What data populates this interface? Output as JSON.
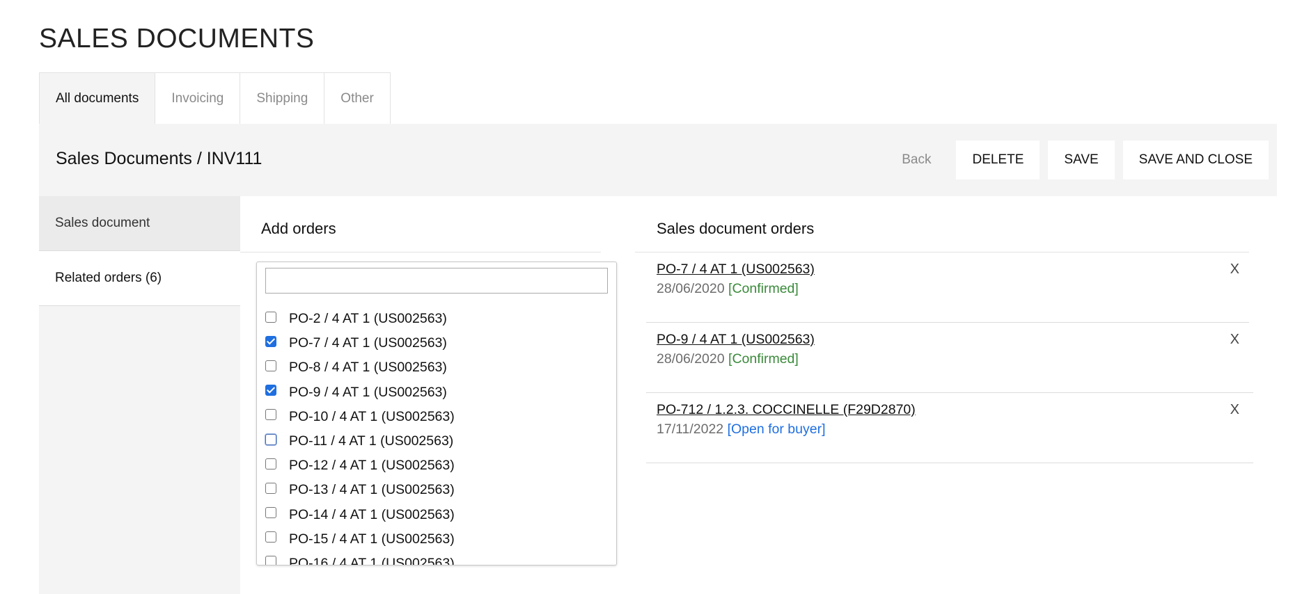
{
  "page": {
    "title": "SALES DOCUMENTS"
  },
  "tabs": [
    {
      "label": "All documents",
      "active": true
    },
    {
      "label": "Invoicing",
      "active": false
    },
    {
      "label": "Shipping",
      "active": false
    },
    {
      "label": "Other",
      "active": false
    }
  ],
  "header": {
    "breadcrumb": "Sales Documents / INV111",
    "back_label": "Back",
    "delete_label": "DELETE",
    "save_label": "SAVE",
    "save_close_label": "SAVE AND CLOSE"
  },
  "sidebar": {
    "items": [
      {
        "label": "Sales document"
      },
      {
        "label": "Related orders (6)"
      }
    ]
  },
  "add_orders": {
    "title": "Add orders",
    "search_value": "",
    "search_placeholder": "",
    "options": [
      {
        "label": "PO-2 / 4 AT 1 (US002563)",
        "checked": false
      },
      {
        "label": "PO-7 / 4 AT 1 (US002563)",
        "checked": true
      },
      {
        "label": "PO-8 / 4 AT 1 (US002563)",
        "checked": false
      },
      {
        "label": "PO-9 / 4 AT 1 (US002563)",
        "checked": true
      },
      {
        "label": "PO-10 / 4 AT 1 (US002563)",
        "checked": false
      },
      {
        "label": "PO-11 / 4 AT 1 (US002563)",
        "checked": false
      },
      {
        "label": "PO-12 / 4 AT 1 (US002563)",
        "checked": false
      },
      {
        "label": "PO-13 / 4 AT 1 (US002563)",
        "checked": false
      },
      {
        "label": "PO-14 / 4 AT 1 (US002563)",
        "checked": false
      },
      {
        "label": "PO-15 / 4 AT 1 (US002563)",
        "checked": false
      },
      {
        "label": "PO-16 / 4 AT 1 (US002563)",
        "checked": false
      }
    ]
  },
  "sales_document_orders": {
    "title": "Sales document orders",
    "remove_label": "X",
    "orders": [
      {
        "name": "PO-7 / 4 AT 1 (US002563)",
        "date": "28/06/2020",
        "status": "[Confirmed]"
      },
      {
        "name": "PO-9 / 4 AT 1 (US002563)",
        "date": "28/06/2020",
        "status": "[Confirmed]"
      },
      {
        "name": "PO-712 / 1.2.3. COCCINELLE (F29D2870)",
        "date": "17/11/2022",
        "status": "[Open for buyer]"
      }
    ]
  },
  "colors": {
    "confirmed": "#3a8a3a",
    "open": "#1f6fe0",
    "panel_bg": "#f4f4f4"
  }
}
